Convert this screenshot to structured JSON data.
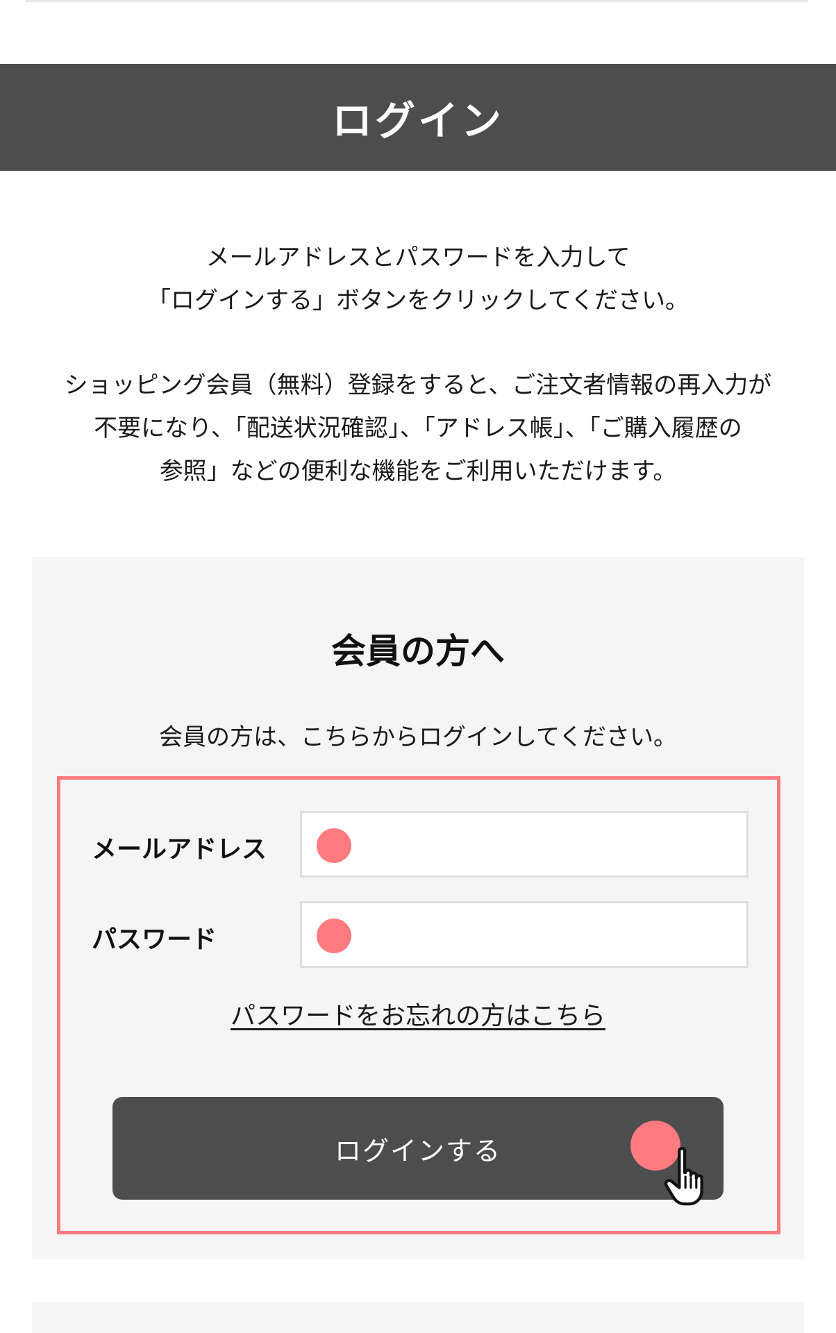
{
  "header": {
    "title": "ログイン"
  },
  "intro": {
    "line1": "メールアドレスとパスワードを入力して",
    "line2": "「ログインする」ボタンをクリックしてください。"
  },
  "benefits": {
    "line1": "ショッピング会員（無料）登録をすると、ご注文者情報の再入力が",
    "line2": "不要になり、「配送状況確認」、「アドレス帳」、「ご購入履歴の",
    "line3": "参照」などの便利な機能をご利用いただけます。"
  },
  "member": {
    "heading": "会員の方へ",
    "subtext": "会員の方は、こちらからログインしてください。",
    "email_label": "メールアドレス",
    "email_value": "",
    "password_label": "パスワード",
    "password_value": "",
    "forgot_link": "パスワードをお忘れの方はこちら",
    "login_button": "ログインする"
  },
  "colors": {
    "header_bg": "#4d4d4d",
    "panel_bg": "#f5f5f5",
    "highlight": "#ff7b7f",
    "button_bg": "#4d4d4d"
  },
  "icons": {
    "cursor": "hand-pointer-icon"
  }
}
